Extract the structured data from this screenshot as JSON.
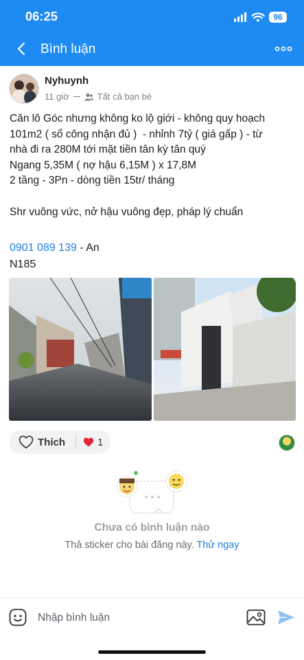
{
  "status_bar": {
    "time": "06:25",
    "battery": "96"
  },
  "header": {
    "title": "Bình luận"
  },
  "post": {
    "author": "Nyhuynh",
    "time_ago": "11 giờ",
    "audience": "Tất cả bạn bè",
    "body": "Căn lô Góc nhưng không ko lộ giới - không quy hoạch\n101m2 ( sổ công nhận đủ )  - nhỉnh 7tỷ ( giá gấp ) - từ\nnhà đi ra 280M tới mặt tiền tân kỳ tân quý\nNgang 5,35M ( nợ hậu 6,15M ) x 17,8M\n2 tầng - 3Pn - dòng tiền 15tr/ tháng\n\nShr vuông vức, nở hậu vuông đẹp, pháp lý chuẩn",
    "phone": "0901 089 139",
    "phone_suffix": " - An",
    "code": "N185",
    "like_label": "Thích",
    "reaction_count": "1"
  },
  "empty_state": {
    "title": "Chưa có bình luận nào",
    "subtitle": "Thả sticker cho bài đăng này.",
    "action": "Thử ngay"
  },
  "composer": {
    "placeholder": "Nhập bình luận"
  },
  "colors": {
    "accent": "#1e8bf3",
    "link": "#1e7fe0",
    "heart": "#e0243a"
  },
  "icons": [
    "back-icon",
    "more-icon",
    "friends-icon",
    "heart-outline-icon",
    "heart-red-icon",
    "sticker-icon",
    "image-icon",
    "send-icon"
  ]
}
